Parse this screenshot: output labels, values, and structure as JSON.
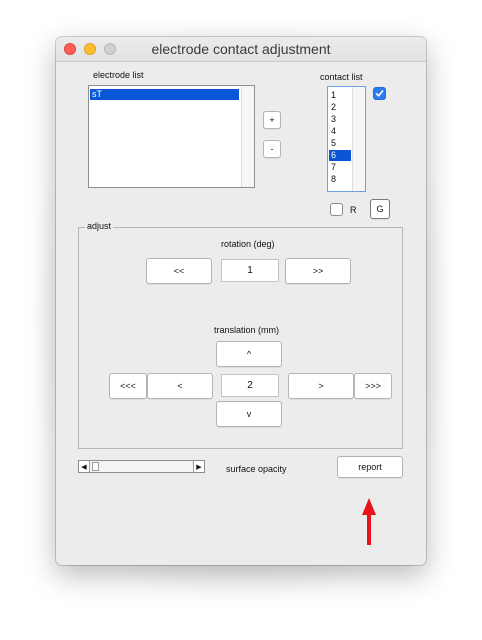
{
  "window": {
    "title": "electrode contact adjustment"
  },
  "electrode_list": {
    "label": "electrode list",
    "items": [
      "sT"
    ],
    "selected_index": 0
  },
  "contact_list": {
    "label": "contact list",
    "items": [
      "1",
      "2",
      "3",
      "4",
      "5",
      "6",
      "7",
      "8"
    ],
    "selected_index": 5,
    "checkbox_checked": true
  },
  "list_buttons": {
    "add_label": "+",
    "remove_label": "-"
  },
  "r_checkbox": {
    "label": "R",
    "checked": false
  },
  "g_button": {
    "label": "G"
  },
  "adjust": {
    "title": "adjust",
    "rotation": {
      "label": "rotation (deg)",
      "left_label": "<<",
      "value": "1",
      "right_label": ">>"
    },
    "translation": {
      "label": "translation (mm)",
      "up_label": "^",
      "far_left_label": "<<<",
      "left_label": "<",
      "value": "2",
      "right_label": ">",
      "far_right_label": ">>>",
      "down_label": "v"
    }
  },
  "opacity": {
    "label": "surface opacity",
    "left_arrow": "◀",
    "right_arrow": "▶",
    "level": 0.05
  },
  "report_button": {
    "label": "report"
  },
  "colors": {
    "selection": "#0a56d4",
    "annotation_arrow": "#e8141b",
    "checkbox_accent": "#2a7bef"
  }
}
